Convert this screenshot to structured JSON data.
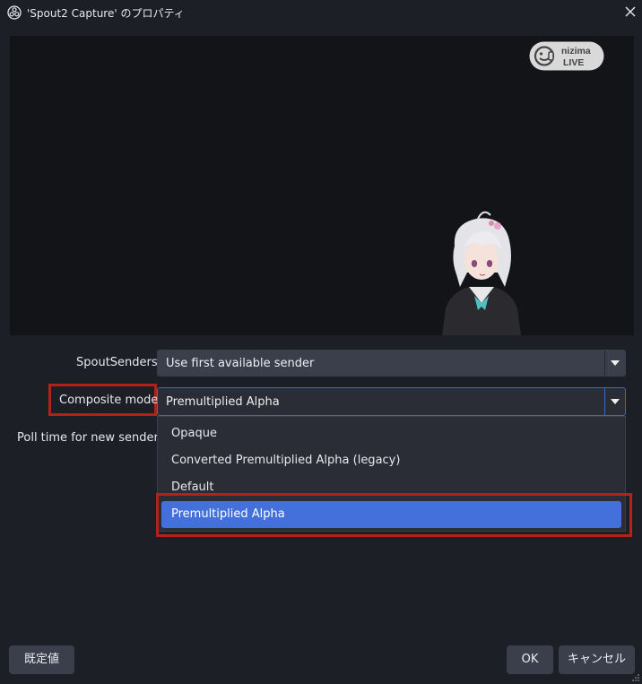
{
  "window": {
    "title": "'Spout2 Capture' のプロパティ"
  },
  "preview": {
    "watermark": {
      "line1": "nizima",
      "line2": "LIVE"
    }
  },
  "form": {
    "spout_senders": {
      "label": "SpoutSenders",
      "value": "Use first available sender"
    },
    "composite_mode": {
      "label": "Composite mode",
      "value": "Premultiplied Alpha"
    },
    "poll_time": {
      "label": "Poll time for new senders"
    }
  },
  "dropdown": {
    "options": [
      {
        "label": "Opaque"
      },
      {
        "label": "Converted Premultiplied Alpha (legacy)"
      },
      {
        "label": "Default"
      },
      {
        "label": "Premultiplied Alpha"
      }
    ],
    "selected_label": "Premultiplied Alpha"
  },
  "buttons": {
    "defaults": "既定値",
    "ok": "OK",
    "cancel": "キャンセル"
  },
  "colors": {
    "background": "#1d1f26",
    "preview_bg": "#131418",
    "combo_bg": "#3b3f4c",
    "accent_selected": "#4470dc",
    "annotation_red": "#b3221a"
  },
  "icons": [
    "obs-logo-icon",
    "close-icon",
    "dropdown-arrow-icon",
    "nizima-live-logo",
    "resize-grip-icon"
  ]
}
